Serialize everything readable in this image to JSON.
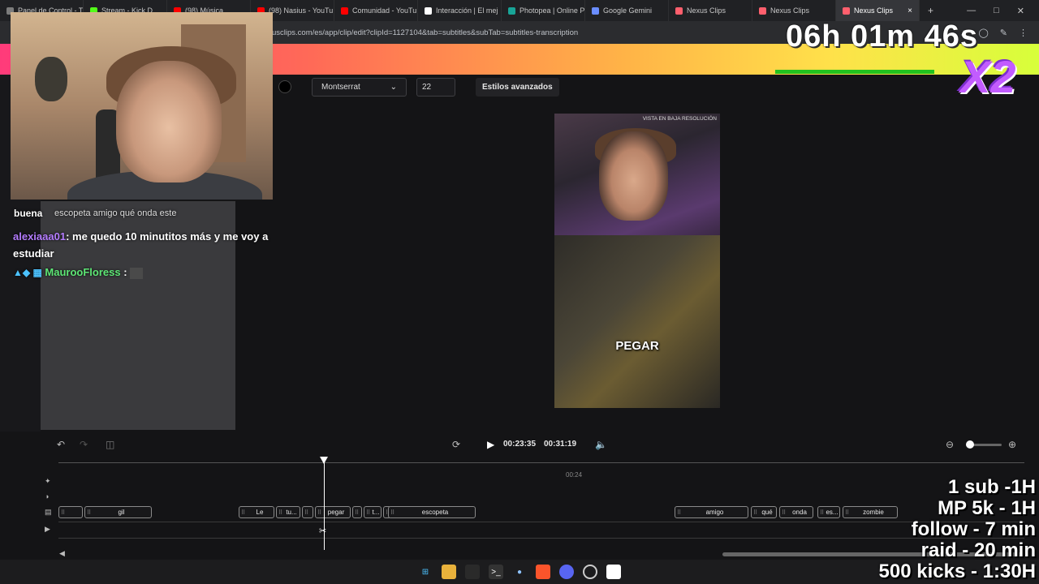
{
  "browser": {
    "tabs": [
      {
        "label": "Panel de Control - T",
        "color": "#7c7c7c"
      },
      {
        "label": "Stream - Kick D",
        "color": "#53fc18"
      },
      {
        "label": "(98) Música",
        "color": "#ff0000"
      },
      {
        "label": "(98) Nasius - YouTu",
        "color": "#ff0000"
      },
      {
        "label": "Comunidad - YouTu",
        "color": "#ff0000"
      },
      {
        "label": "Interacción | El mej",
        "color": "#ffffff"
      },
      {
        "label": "Photopea | Online P",
        "color": "#18a497"
      },
      {
        "label": "Google Gemini",
        "color": "#6a8dff"
      },
      {
        "label": "Nexus Clips",
        "color": "#ff5f6d"
      },
      {
        "label": "Nexus Clips",
        "color": "#ff5f6d"
      },
      {
        "label": "Nexus Clips",
        "color": "#ff5f6d",
        "active": true
      }
    ],
    "close_glyph": "×",
    "new_tab_glyph": "+",
    "url": "usclips.com/es/app/clip/edit?clipId=1127104&tab=subtitles&subTab=subtitles-transcription"
  },
  "toolbar": {
    "font": "Montserrat",
    "font_size": "22",
    "advanced": "Estilos avanzados"
  },
  "preview": {
    "lowres": "VISTA EN BAJA RESOLUCIÓN",
    "caption": "PEGAR"
  },
  "player": {
    "current_time": "00:23:35",
    "total_time": "00:31:19",
    "ruler_label": "00:24"
  },
  "subtitles": [
    "gil",
    "Le",
    "tu...",
    "pegar",
    "t...",
    "escopeta",
    "amigo",
    "qué",
    "onda",
    "es...",
    "zombie"
  ],
  "overlay": {
    "timer": "06h 01m 46s",
    "x2": "X2",
    "chat_popup_user": "buena",
    "chat_popup_text": "escopeta amigo qué onda este",
    "chat1_user": "alexiaaa01",
    "chat1_text": ": me quedo 10 minutitos más y me voy a estudiar",
    "chat2_user": "MaurooFloress",
    "chat2_text": " :",
    "goals": [
      "1 sub -1H",
      "MP 5k - 1H",
      "follow - 7 min",
      "raid - 20 min",
      "500 kicks - 1:30H"
    ]
  }
}
